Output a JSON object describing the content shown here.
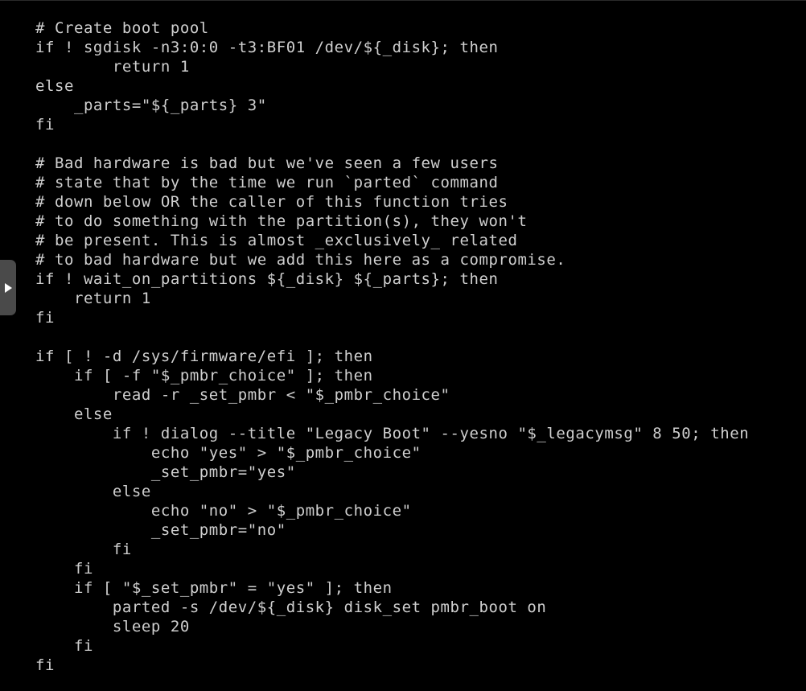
{
  "window": {
    "title": "Shell script source view",
    "background_color": "#000000",
    "text_color": "#cfcfcf"
  },
  "drawer_handle": {
    "name": "expand-panel-handle",
    "icon": "triangle-right-icon",
    "color": "#4a4a4a",
    "icon_color": "#ffffff"
  },
  "code": {
    "language": "bash",
    "font_size_px": 19,
    "line_height_px": 24,
    "lines": [
      "# Create boot pool",
      "if ! sgdisk -n3:0:0 -t3:BF01 /dev/${_disk}; then",
      "        return 1",
      "else",
      "    _parts=\"${_parts} 3\"",
      "fi",
      "",
      "# Bad hardware is bad but we've seen a few users",
      "# state that by the time we run `parted` command",
      "# down below OR the caller of this function tries",
      "# to do something with the partition(s), they won't",
      "# be present. This is almost _exclusively_ related",
      "# to bad hardware but we add this here as a compromise.",
      "if ! wait_on_partitions ${_disk} ${_parts}; then",
      "    return 1",
      "fi",
      "",
      "if [ ! -d /sys/firmware/efi ]; then",
      "    if [ -f \"$_pmbr_choice\" ]; then",
      "        read -r _set_pmbr < \"$_pmbr_choice\"",
      "    else",
      "        if ! dialog --title \"Legacy Boot\" --yesno \"$_legacymsg\" 8 50; then",
      "            echo \"yes\" > \"$_pmbr_choice\"",
      "            _set_pmbr=\"yes\"",
      "        else",
      "            echo \"no\" > \"$_pmbr_choice\"",
      "            _set_pmbr=\"no\"",
      "        fi",
      "    fi",
      "    if [ \"$_set_pmbr\" = \"yes\" ]; then",
      "        parted -s /dev/${_disk} disk_set pmbr_boot on",
      "        sleep 20",
      "    fi",
      "fi"
    ]
  }
}
